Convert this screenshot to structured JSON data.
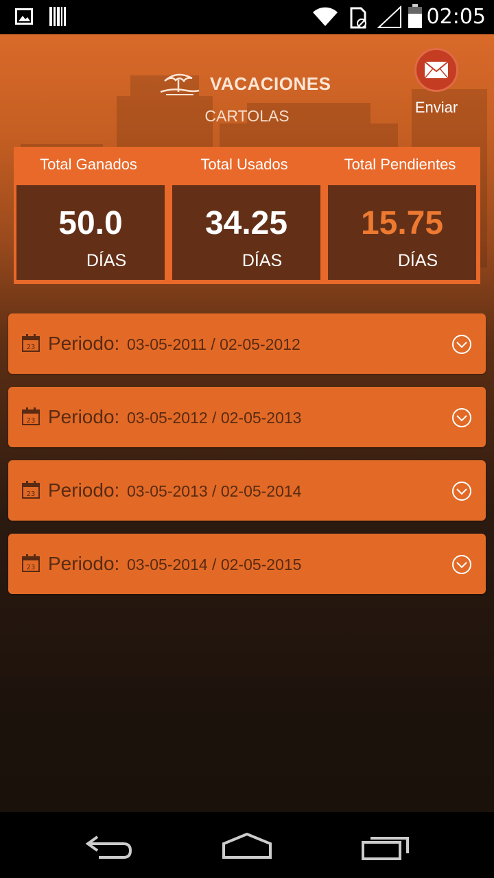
{
  "status_bar": {
    "time": "02:05",
    "icons": [
      "image-icon",
      "barcode-icon",
      "wifi-icon",
      "sim-icon",
      "signal-icon",
      "battery-icon"
    ]
  },
  "header": {
    "title": "VACACIONES",
    "subtitle": "CARTOLAS",
    "send_label": "Enviar",
    "title_icon": "beach-umbrella-icon",
    "send_icon": "envelope-icon"
  },
  "summary": {
    "columns": [
      {
        "label": "Total Ganados",
        "value": "50.0",
        "unit": "DÍAS"
      },
      {
        "label": "Total Usados",
        "value": "34.25",
        "unit": "DÍAS"
      },
      {
        "label": "Total Pendientes",
        "value": "15.75",
        "unit": "DÍAS"
      }
    ]
  },
  "periods": [
    {
      "label": "Periodo:",
      "range": "03-05-2011 / 02-05-2012"
    },
    {
      "label": "Periodo:",
      "range": "03-05-2012 / 02-05-2013"
    },
    {
      "label": "Periodo:",
      "range": "03-05-2013 / 02-05-2014"
    },
    {
      "label": "Periodo:",
      "range": "03-05-2014 / 02-05-2015"
    }
  ],
  "calendar_day": "23",
  "nav": {
    "icons": [
      "back-icon",
      "home-icon",
      "recent-apps-icon"
    ]
  },
  "colors": {
    "accent": "#e8692a",
    "period_bg": "#e26a26",
    "pending_value": "#ee7a32",
    "send_button": "#c43c22"
  }
}
